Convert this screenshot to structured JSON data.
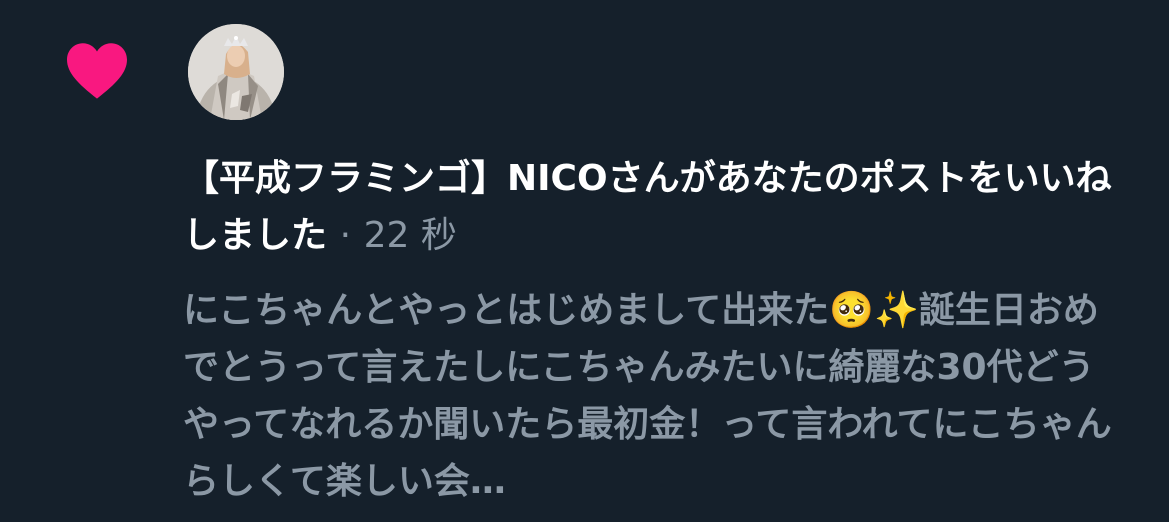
{
  "notification": {
    "type_icon": "heart-icon",
    "accent_color": "#f91880",
    "avatar": "avatar",
    "user_name": "【平成フラミンゴ】NICO",
    "action_text": "さんがあなたのポストをいいねしました",
    "separator": "·",
    "timestamp": "22 秒",
    "post_text": "にこちゃんとやっとはじめまして出来た🥺✨誕生日おめでとうって言えたしにこちゃんみたいに綺麗な30代どうやってなれるか聞いたら最初金！って言われてにこちゃんらしくて楽しい会…"
  },
  "colors": {
    "background": "#15202b",
    "primary_text": "#ffffff",
    "secondary_text": "#8b98a5"
  }
}
